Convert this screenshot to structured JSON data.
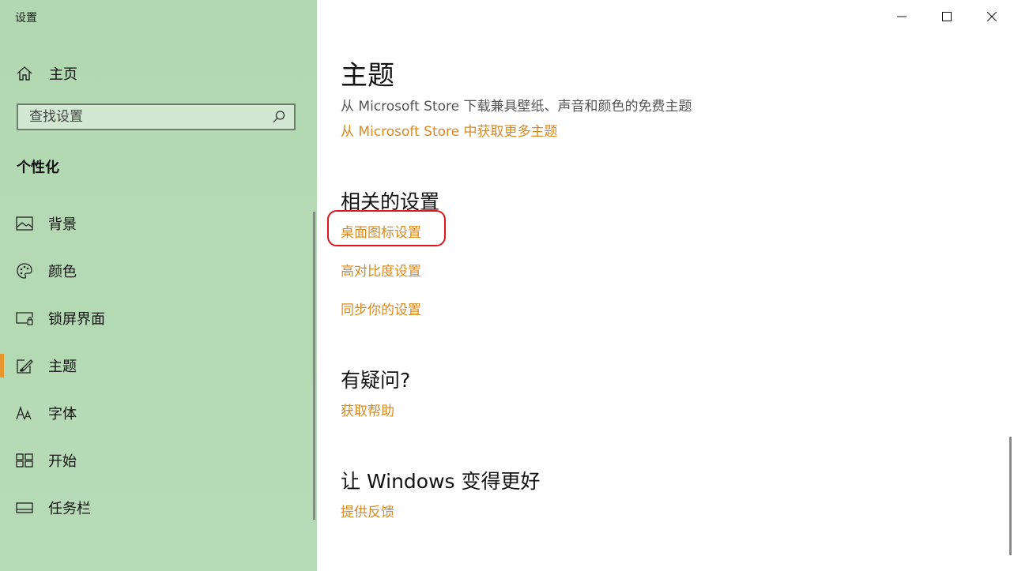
{
  "window": {
    "title": "设置",
    "minimize_glyph": "—",
    "maximize_glyph": "☐",
    "close_glyph": "✕"
  },
  "sidebar": {
    "home_label": "主页",
    "search_placeholder": "查找设置",
    "section_title": "个性化",
    "items": [
      {
        "label": "背景",
        "icon": "picture-icon"
      },
      {
        "label": "颜色",
        "icon": "palette-icon"
      },
      {
        "label": "锁屏界面",
        "icon": "lock-screen-icon"
      },
      {
        "label": "主题",
        "icon": "theme-icon",
        "selected": true
      },
      {
        "label": "字体",
        "icon": "font-icon"
      },
      {
        "label": "开始",
        "icon": "start-icon"
      },
      {
        "label": "任务栏",
        "icon": "taskbar-icon"
      }
    ]
  },
  "main": {
    "title": "主题",
    "description": "从 Microsoft Store 下载兼具壁纸、声音和颜色的免费主题",
    "store_link": "从 Microsoft Store 中获取更多主题",
    "related_title": "相关的设置",
    "related_links": [
      "桌面图标设置",
      "高对比度设置",
      "同步你的设置"
    ],
    "question_title": "有疑问?",
    "help_link": "获取帮助",
    "feedback_title": "让 Windows 变得更好",
    "feedback_link": "提供反馈"
  },
  "colors": {
    "sidebar_bg": "#b2d8b2",
    "accent": "#e8962e",
    "link": "#d98a1f",
    "highlight_circle": "#e0141a"
  }
}
